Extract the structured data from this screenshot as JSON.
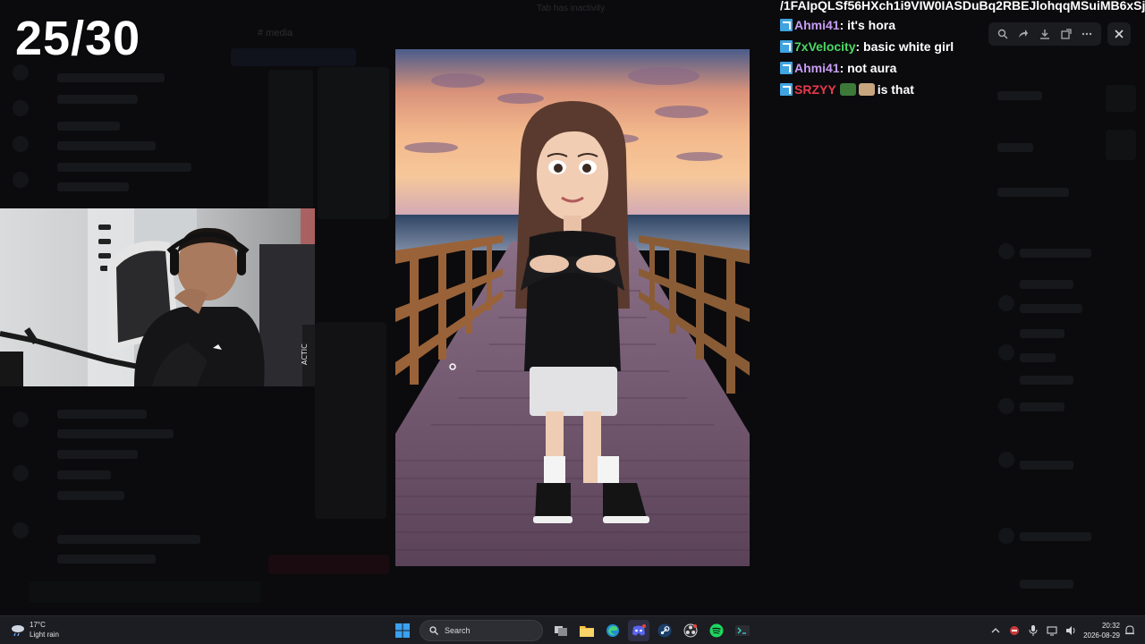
{
  "counter": "25/30",
  "background": {
    "window_title": "Tab has inactivity",
    "channel_name": "# media"
  },
  "chat": {
    "url_fragment": "/1FAIpQLSf56HXch1i9VIW0IASDuBq2RBEJlohqqMSuiMB6xSja",
    "messages": [
      {
        "user": "Ahmi41",
        "text": ": it's hora",
        "color": "#c79cf5"
      },
      {
        "user": "7xVelocity",
        "text": ": basic white girl",
        "color": "#4cd964"
      },
      {
        "user": "Ahmi41",
        "text": ": not aura",
        "color": "#c79cf5"
      },
      {
        "user": "SRZYY",
        "text": " is that",
        "color": "#e63a4b"
      }
    ]
  },
  "viewer_toolbar": {
    "icons": [
      "zoom-icon",
      "forward-icon",
      "download-icon",
      "open-external-icon",
      "more-icon"
    ],
    "close": "close-icon"
  },
  "webcam": {
    "chair_label": "ACTIC"
  },
  "taskbar": {
    "weather_temp": "17°C",
    "weather_desc": "Light rain",
    "search_label": "Search",
    "time": "20:32",
    "date": "2026-08-29",
    "accent": "#5865f2"
  }
}
